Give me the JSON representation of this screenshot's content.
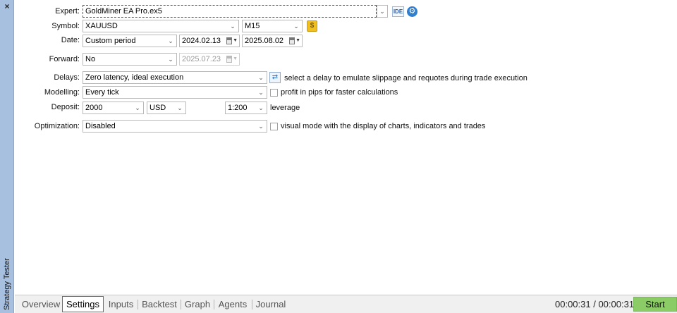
{
  "panel": {
    "title": "Strategy Tester",
    "close_glyph": "×"
  },
  "form": {
    "expert": {
      "label": "Expert:",
      "value": "GoldMiner EA Pro.ex5",
      "ide_label": "IDE",
      "settings_icon": "gear-icon"
    },
    "symbol": {
      "label": "Symbol:",
      "value": "XAUUSD",
      "timeframe": "M15",
      "symbol_info_icon": "dollar-icon"
    },
    "date": {
      "label": "Date:",
      "period": "Custom period",
      "from": "2024.02.13",
      "to": "2025.08.02"
    },
    "forward": {
      "label": "Forward:",
      "value": "No",
      "date": "2025.07.23"
    },
    "delays": {
      "label": "Delays:",
      "value": "Zero latency, ideal execution",
      "hint": "select a delay to emulate slippage and requotes during trade execution"
    },
    "modelling": {
      "label": "Modelling:",
      "value": "Every tick",
      "checkbox_label": "profit in pips for faster calculations",
      "checked": false
    },
    "deposit": {
      "label": "Deposit:",
      "amount": "2000",
      "currency": "USD",
      "leverage": "1:200",
      "leverage_label": "leverage"
    },
    "optimization": {
      "label": "Optimization:",
      "value": "Disabled",
      "checkbox_label": "visual mode with the display of charts, indicators and trades",
      "checked": false
    }
  },
  "tabs": [
    {
      "label": "Overview"
    },
    {
      "label": "Settings",
      "active": true
    },
    {
      "label": "Inputs"
    },
    {
      "label": "Backtest"
    },
    {
      "label": "Graph"
    },
    {
      "label": "Agents"
    },
    {
      "label": "Journal"
    }
  ],
  "status": {
    "timer": "00:00:31 / 00:00:31",
    "start_label": "Start"
  },
  "colors": {
    "strip": "#a7c0e0",
    "start_button": "#8ccc66",
    "accent": "#2f7fd0"
  }
}
